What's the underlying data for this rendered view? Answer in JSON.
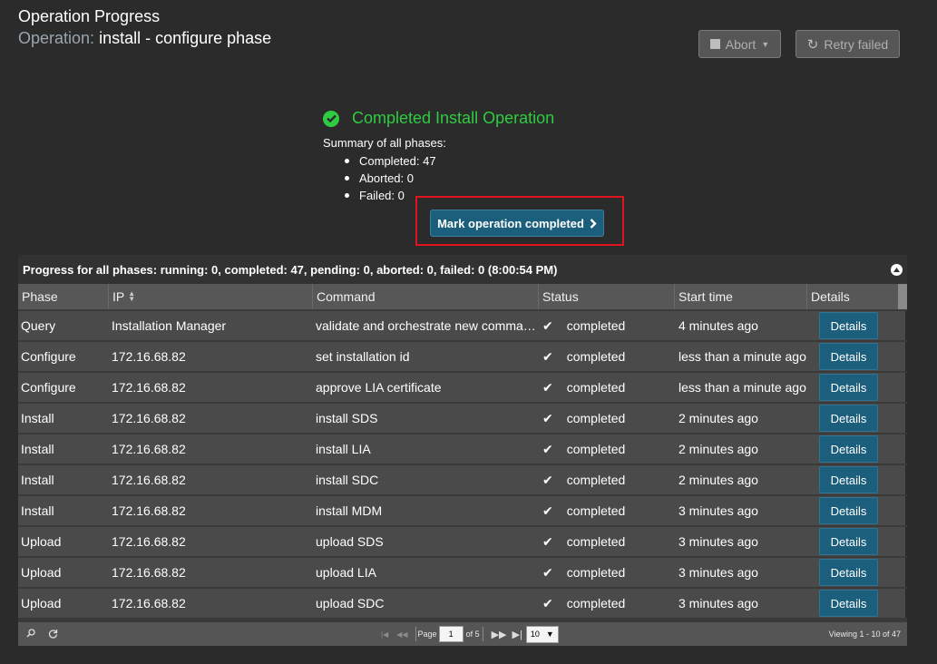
{
  "header": {
    "title": "Operation Progress",
    "operation_label": "Operation:",
    "operation_value": "install - configure phase"
  },
  "toolbar": {
    "abort_label": "Abort",
    "retry_label": "Retry failed"
  },
  "summary": {
    "title": "Completed Install Operation",
    "label": "Summary of all phases:",
    "items": [
      "Completed: 47",
      "Aborted: 0",
      "Failed: 0"
    ],
    "mark_button": "Mark operation completed"
  },
  "progress": {
    "header": "Progress for all phases: running: 0, completed: 47, pending: 0, aborted: 0, failed: 0 (8:00:54 PM)",
    "columns": [
      "Phase",
      "IP",
      "Command",
      "Status",
      "Start time",
      "Details"
    ],
    "rows": [
      {
        "phase": "Query",
        "ip": "Installation Manager",
        "command": "validate and orchestrate new command…",
        "status": "completed",
        "start": "4 minutes ago",
        "details": "Details"
      },
      {
        "phase": "Configure",
        "ip": "172.16.68.82",
        "command": "set installation id",
        "status": "completed",
        "start": "less than a minute ago",
        "details": "Details"
      },
      {
        "phase": "Configure",
        "ip": "172.16.68.82",
        "command": "approve LIA certificate",
        "status": "completed",
        "start": "less than a minute ago",
        "details": "Details"
      },
      {
        "phase": "Install",
        "ip": "172.16.68.82",
        "command": "install SDS",
        "status": "completed",
        "start": "2 minutes ago",
        "details": "Details"
      },
      {
        "phase": "Install",
        "ip": "172.16.68.82",
        "command": "install LIA",
        "status": "completed",
        "start": "2 minutes ago",
        "details": "Details"
      },
      {
        "phase": "Install",
        "ip": "172.16.68.82",
        "command": "install SDC",
        "status": "completed",
        "start": "2 minutes ago",
        "details": "Details"
      },
      {
        "phase": "Install",
        "ip": "172.16.68.82",
        "command": "install MDM",
        "status": "completed",
        "start": "3 minutes ago",
        "details": "Details"
      },
      {
        "phase": "Upload",
        "ip": "172.16.68.82",
        "command": "upload SDS",
        "status": "completed",
        "start": "3 minutes ago",
        "details": "Details"
      },
      {
        "phase": "Upload",
        "ip": "172.16.68.82",
        "command": "upload LIA",
        "status": "completed",
        "start": "3 minutes ago",
        "details": "Details"
      },
      {
        "phase": "Upload",
        "ip": "172.16.68.82",
        "command": "upload SDC",
        "status": "completed",
        "start": "3 minutes ago",
        "details": "Details"
      }
    ]
  },
  "pager": {
    "page_label": "Page",
    "page_value": "1",
    "of_label": "of 5",
    "page_size": "10",
    "viewing": "Viewing 1 - 10 of 47"
  },
  "colors": {
    "accent_button": "#1b5f7c",
    "success_green": "#2ecc40",
    "highlight_red": "#e0141e"
  }
}
